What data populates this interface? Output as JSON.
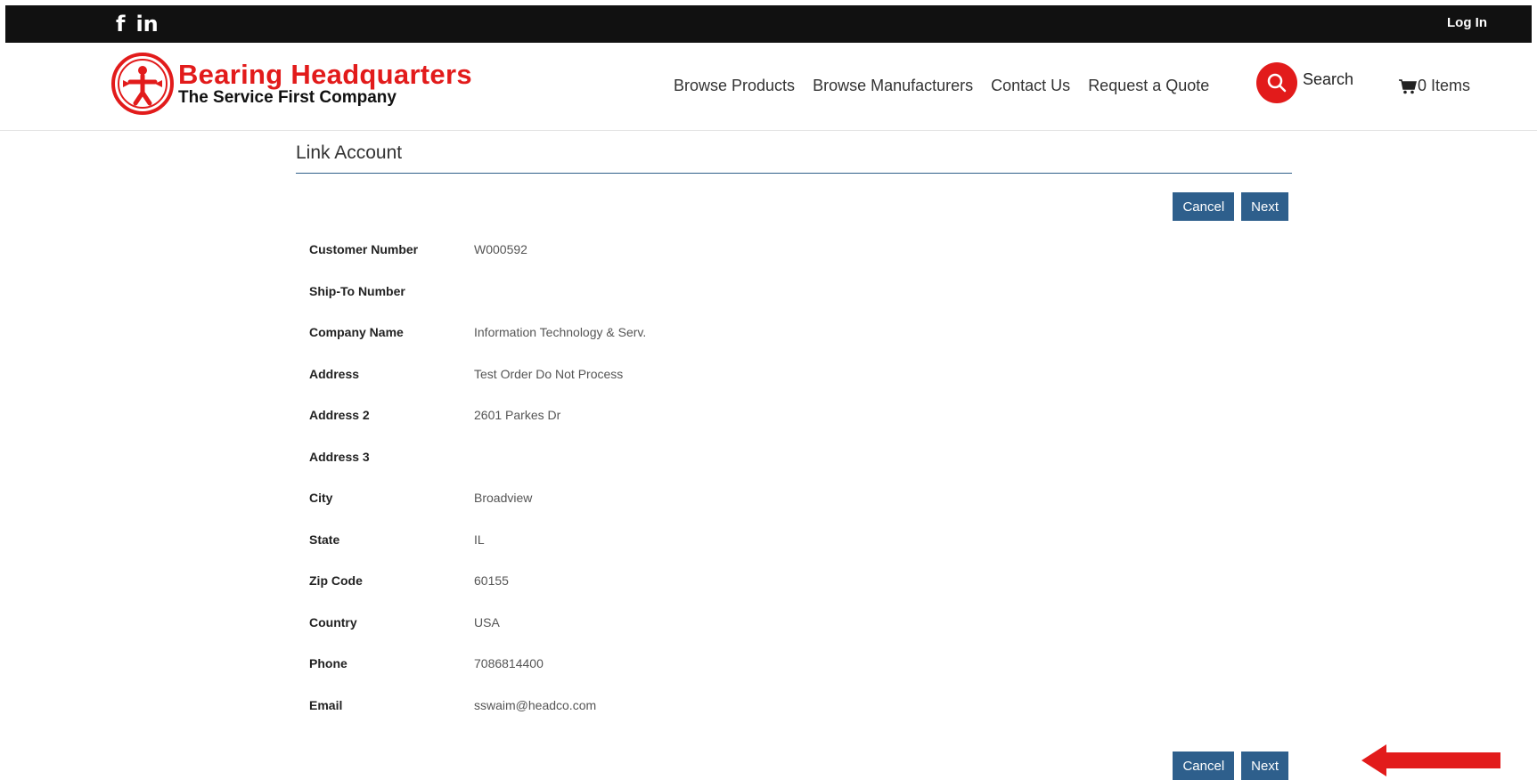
{
  "topbar": {
    "social": [
      "f",
      "in"
    ],
    "login_label": "Log In"
  },
  "header": {
    "logo_title": "Bearing Headquarters",
    "logo_subtitle": "The Service First Company",
    "nav": [
      "Browse Products",
      "Browse Manufacturers",
      "Contact Us",
      "Request a Quote"
    ],
    "search_label": "Search",
    "cart_label": "0 Items"
  },
  "page": {
    "title": "Link Account",
    "cancel_label": "Cancel",
    "next_label": "Next",
    "fields": [
      {
        "label": "Customer Number",
        "value": "W000592"
      },
      {
        "label": "Ship-To Number",
        "value": ""
      },
      {
        "label": "Company Name",
        "value": "Information Technology & Serv."
      },
      {
        "label": "Address",
        "value": "Test Order Do Not Process"
      },
      {
        "label": "Address 2",
        "value": "2601 Parkes Dr"
      },
      {
        "label": "Address 3",
        "value": ""
      },
      {
        "label": "City",
        "value": "Broadview"
      },
      {
        "label": "State",
        "value": "IL"
      },
      {
        "label": "Zip Code",
        "value": "60155"
      },
      {
        "label": "Country",
        "value": "USA"
      },
      {
        "label": "Phone",
        "value": "7086814400"
      },
      {
        "label": "Email",
        "value": "sswaim@headco.com"
      }
    ]
  },
  "colors": {
    "brand_red": "#e21b1b",
    "button_blue": "#2e5f8c",
    "topbar": "#111111"
  }
}
